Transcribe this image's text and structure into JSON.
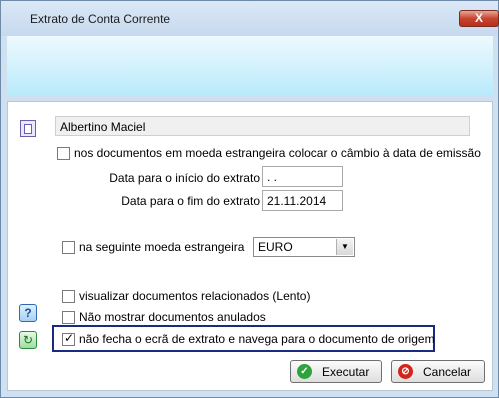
{
  "window": {
    "title": "Extrato de Conta Corrente",
    "close_label": "X"
  },
  "account": {
    "name": "Albertino Maciel"
  },
  "options": {
    "foreign_rate_label": "nos documentos em moeda estrangeira colocar o câmbio à data de emissão",
    "foreign_rate_checked": false,
    "currency_label": "na seguinte moeda estrangeira",
    "currency_checked": false,
    "show_related_label": "visualizar documentos relacionados (Lento)",
    "show_related_checked": false,
    "hide_cancelled_label": "Não mostrar documentos anulados",
    "hide_cancelled_checked": false,
    "keep_open_label": "não fecha o ecrã de extrato e navega para o documento de origem",
    "keep_open_checked": true
  },
  "dates": {
    "start_label": "Data para o início do extrato",
    "start_value": ". .",
    "end_label": "Data para o fim do extrato",
    "end_value": "21.11.2014"
  },
  "currency": {
    "selected": "EURO"
  },
  "buttons": {
    "execute": "Executar",
    "cancel": "Cancelar"
  },
  "icons": {
    "book": "book-icon",
    "help": "help-icon",
    "refresh": "refresh-icon",
    "execute": "check-circle-icon",
    "cancel": "cancel-circle-icon"
  }
}
